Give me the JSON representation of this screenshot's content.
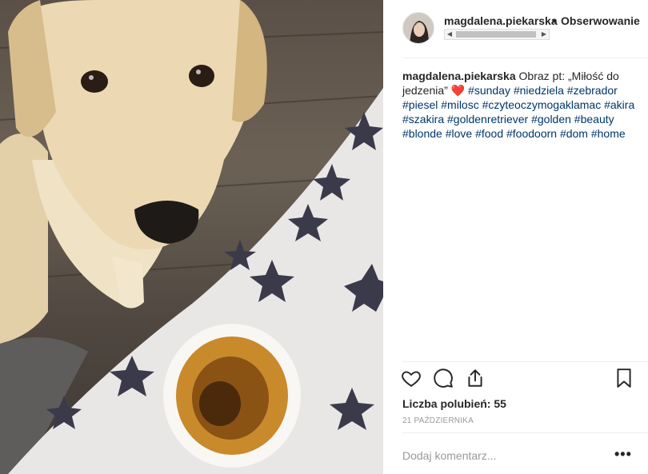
{
  "post": {
    "username": "magdalena.piekarska",
    "separator": "•",
    "follow_label": "Obserwowanie",
    "caption": {
      "username": "magdalena.piekarska",
      "text": "Obraz pt: „Miłość do jedzenia” ❤️",
      "hashtags": "#sunday #niedziela #zebrador #piesel #milosc #czyteoczymogaklamac #akira #szakira #goldenretriever #golden #beauty #blonde #love #food #foodoorn #dom #home"
    },
    "likes_label": "Liczba polubień: 55",
    "date": "21 października",
    "comment_placeholder": "Dodaj komentarz...",
    "more_label": "•••"
  },
  "icons": {
    "like": "heart-icon",
    "comment": "speech-bubble-icon",
    "share": "share-icon",
    "save": "bookmark-icon"
  }
}
